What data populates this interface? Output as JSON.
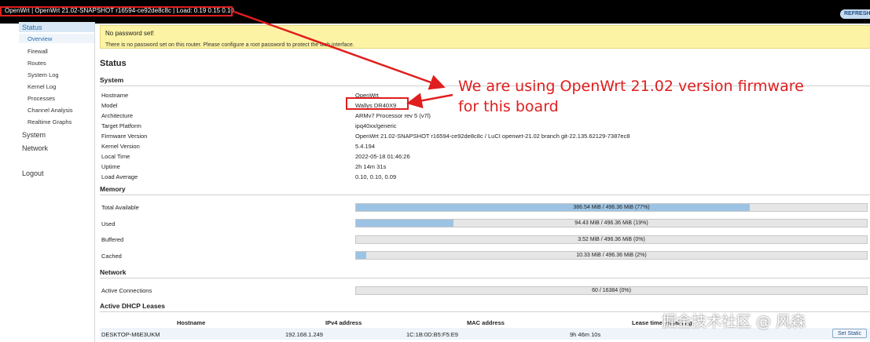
{
  "topbar": {
    "title": "OpenWrt | OpenWrt 21.02-SNAPSHOT r16594-ce92de8c8c | Load: 0.19 0.15 0.10",
    "refresh_label": "REFRESH"
  },
  "sidebar": {
    "status": "Status",
    "items": [
      "Overview",
      "Firewall",
      "Routes",
      "System Log",
      "Kernel Log",
      "Processes",
      "Channel Analysis",
      "Realtime Graphs"
    ],
    "system": "System",
    "network": "Network",
    "logout": "Logout"
  },
  "warning": {
    "title": "No password set!",
    "text": "There is no password set on this router. Please configure a root password to protect the web interface."
  },
  "page_title": "Status",
  "system": {
    "heading": "System",
    "rows": [
      {
        "label": "Hostname",
        "value": "OpenWrt"
      },
      {
        "label": "Model",
        "value": "Wallys DR40X9"
      },
      {
        "label": "Architecture",
        "value": "ARMv7 Processor rev 5 (v7l)"
      },
      {
        "label": "Target Platform",
        "value": "ipq40xx/generic"
      },
      {
        "label": "Firmware Version",
        "value": "OpenWrt 21.02-SNAPSHOT r16594-ce92de8c8c / LuCI openwrt-21.02 branch git-22.135.62129-7387ec8"
      },
      {
        "label": "Kernel Version",
        "value": "5.4.194"
      },
      {
        "label": "Local Time",
        "value": "2022-05-18 01:46:26"
      },
      {
        "label": "Uptime",
        "value": "2h 14m 31s"
      },
      {
        "label": "Load Average",
        "value": "0.10, 0.10, 0.09"
      }
    ]
  },
  "memory": {
    "heading": "Memory",
    "rows": [
      {
        "label": "Total Available",
        "text": "386.54 MiB / 496.36 MiB (77%)",
        "fraction": 0.77
      },
      {
        "label": "Used",
        "text": "94.43 MiB / 496.36 MiB (19%)",
        "fraction": 0.19
      },
      {
        "label": "Buffered",
        "text": "3.52 MiB / 496.36 MiB (0%)",
        "fraction": 0.0
      },
      {
        "label": "Cached",
        "text": "10.33 MiB / 496.36 MiB (2%)",
        "fraction": 0.02
      }
    ]
  },
  "network": {
    "heading": "Network",
    "rows": [
      {
        "label": "Active Connections",
        "text": "60 / 16384 (0%)",
        "fraction": 0.0
      }
    ]
  },
  "dhcp": {
    "heading": "Active DHCP Leases",
    "columns": [
      "Hostname",
      "IPv4 address",
      "MAC address",
      "Lease time remaining"
    ],
    "row": {
      "hostname": "DESKTOP-M6E3UKM",
      "ip": "192.168.1.249",
      "mac": "1C:1B:0D:B5:F5:E9",
      "lease": "9h 46m 10s"
    },
    "action_label": "Set Static"
  },
  "annotation": {
    "line1": "We are using OpenWrt 21.02 version firmware",
    "line2": "for this board"
  },
  "watermark": "掘金技术社区 @ 风森",
  "colors": {
    "annotation": "#e01e1e",
    "bar_fill": "#9cc3e4",
    "warning_bg": "#fcf3a5",
    "accent": "#2a6cb0"
  }
}
